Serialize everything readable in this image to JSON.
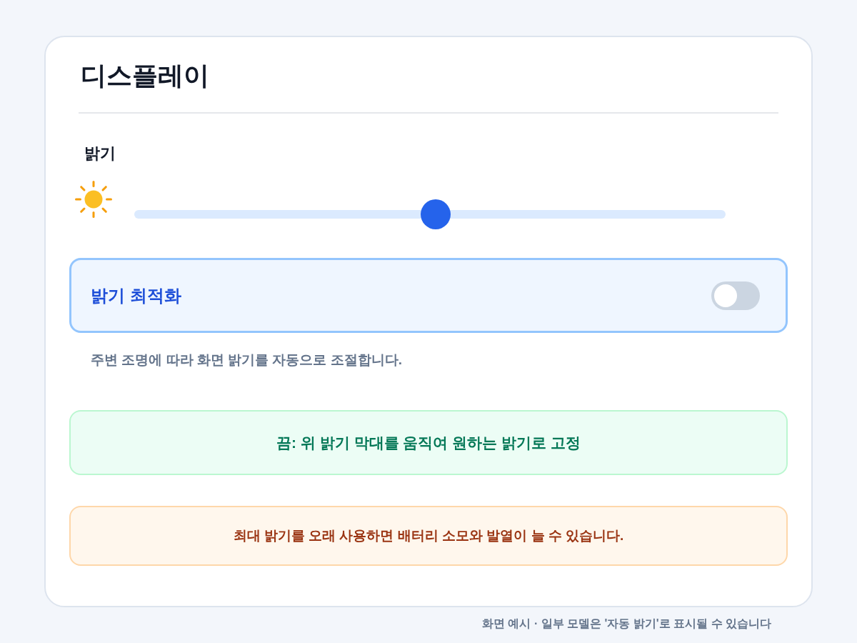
{
  "title": "디스플레이",
  "brightness": {
    "label": "밝기",
    "level": 0.51
  },
  "adaptive_brightness": {
    "label": "밝기 최적화",
    "on": false,
    "description": "주변 조명에 따라 화면 밝기를 자동으로 조절합니다."
  },
  "notes": [
    {
      "kind": "info",
      "text": "끔: 위 밝기 막대를 움직여 원하는 밝기로 고정"
    },
    {
      "kind": "warning",
      "text": "최대 밝기를 오래 사용하면 배터리 소모와 발열이 늘 수 있습니다."
    }
  ],
  "footer": "화면 예시 · 일부 모델은 '자동 밝기'로 표시될 수 있습니다"
}
